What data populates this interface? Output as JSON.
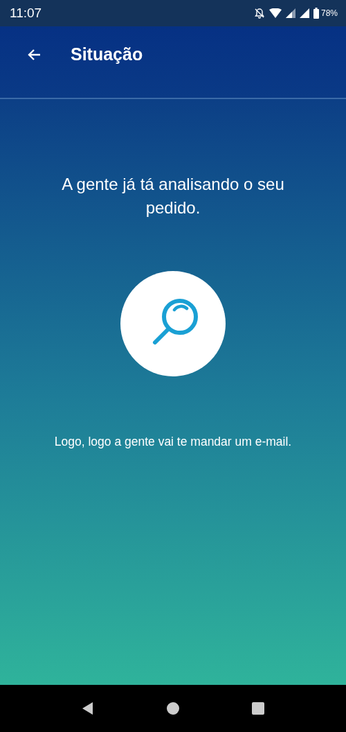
{
  "status_bar": {
    "time": "11:07",
    "battery": "78%"
  },
  "app_bar": {
    "title": "Situação"
  },
  "message": "A gente já tá analisando o seu pedido.",
  "note": "Logo, logo a gente vai te mandar um e-mail."
}
